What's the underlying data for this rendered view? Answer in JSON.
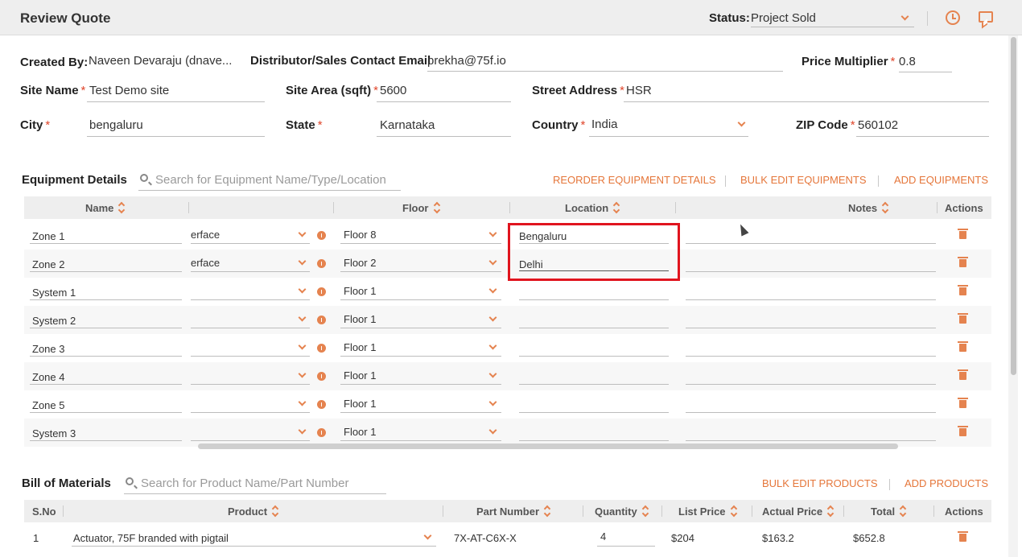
{
  "header": {
    "title": "Review Quote",
    "status_label": "Status:",
    "status_value": "Project Sold"
  },
  "form": {
    "created_by_label": "Created By:",
    "created_by_value": "Naveen Devaraju (dnave...",
    "contact_email_label": "Distributor/Sales Contact Email",
    "contact_email_value": "prekha@75f.io",
    "price_multiplier_label": "Price Multiplier",
    "price_multiplier_value": "0.8",
    "site_name_label": "Site Name",
    "site_name_value": "Test Demo site",
    "site_area_label": "Site Area (sqft)",
    "site_area_value": "5600",
    "street_label": "Street Address",
    "street_value": "HSR",
    "city_label": "City",
    "city_value": "bengaluru",
    "state_label": "State",
    "state_value": "Karnataka",
    "country_label": "Country",
    "country_value": "India",
    "zip_label": "ZIP Code",
    "zip_value": "560102",
    "required_mark": "*"
  },
  "equipment": {
    "title": "Equipment Details",
    "search_placeholder": "Search for Equipment Name/Type/Location",
    "reorder_label": "REORDER EQUIPMENT DETAILS",
    "bulk_edit_label": "BULK EDIT EQUIPMENTS",
    "add_label": "ADD EQUIPMENTS",
    "link_sep": "|",
    "columns": {
      "name": "Name",
      "floor": "Floor",
      "location": "Location",
      "notes": "Notes",
      "actions": "Actions"
    },
    "rows": [
      {
        "name": "Zone 1",
        "type": "erface",
        "floor": "Floor 8",
        "location": "Bengaluru",
        "notes": ""
      },
      {
        "name": "Zone 2",
        "type": "erface",
        "floor": "Floor 2",
        "location": "Delhi",
        "notes": ""
      },
      {
        "name": "System 1",
        "type": "",
        "floor": "Floor 1",
        "location": "",
        "notes": ""
      },
      {
        "name": "System 2",
        "type": "",
        "floor": "Floor 1",
        "location": "",
        "notes": ""
      },
      {
        "name": "Zone 3",
        "type": "",
        "floor": "Floor 1",
        "location": "",
        "notes": ""
      },
      {
        "name": "Zone 4",
        "type": "",
        "floor": "Floor 1",
        "location": "",
        "notes": ""
      },
      {
        "name": "Zone 5",
        "type": "",
        "floor": "Floor 1",
        "location": "",
        "notes": ""
      },
      {
        "name": "System 3",
        "type": "",
        "floor": "Floor 1",
        "location": "",
        "notes": ""
      }
    ]
  },
  "bom": {
    "title": "Bill of Materials",
    "search_placeholder": "Search for Product Name/Part Number",
    "bulk_edit_label": "BULK EDIT PRODUCTS",
    "add_label": "ADD PRODUCTS",
    "columns": {
      "sno": "S.No",
      "product": "Product",
      "part_number": "Part Number",
      "quantity": "Quantity",
      "list_price": "List Price",
      "actual_price": "Actual Price",
      "total": "Total",
      "actions": "Actions"
    },
    "rows": [
      {
        "sno": "1",
        "product": "Actuator, 75F branded with pigtail",
        "part_number": "7X-AT-C6X-X",
        "quantity": "4",
        "list_price": "$204",
        "actual_price": "$163.2",
        "total": "$652.8"
      }
    ]
  },
  "colors": {
    "accent": "#e5763a",
    "required": "#e0462b",
    "highlight": "#e0141e"
  }
}
